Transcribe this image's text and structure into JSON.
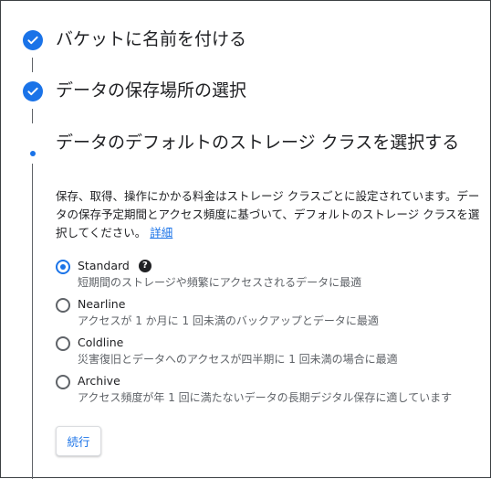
{
  "steps": [
    {
      "title": "バケットに名前を付ける",
      "status": "completed"
    },
    {
      "title": "データの保存場所の選択",
      "status": "completed"
    },
    {
      "title": "データのデフォルトのストレージ クラスを選択する",
      "status": "current"
    }
  ],
  "current_step": {
    "description": "保存、取得、操作にかかる料金はストレージ クラスごとに設定されています。データの保存予定期間とアクセス頻度に基づいて、デフォルトのストレージ クラスを選択してください。",
    "learn_more": "詳細",
    "options": [
      {
        "label": "Standard",
        "description": "短期間のストレージや頻繁にアクセスされるデータに最適",
        "selected": true,
        "has_help": true
      },
      {
        "label": "Nearline",
        "description": "アクセスが 1 か月に 1 回未満のバックアップとデータに最適",
        "selected": false
      },
      {
        "label": "Coldline",
        "description": "災害復旧とデータへのアクセスが四半期に 1 回未満の場合に最適",
        "selected": false
      },
      {
        "label": "Archive",
        "description": "アクセス頻度が年 1 回に満たないデータの長期デジタル保存に適しています",
        "selected": false
      }
    ],
    "help_icon_glyph": "?",
    "continue_label": "続行"
  },
  "colors": {
    "accent": "#1a73e8",
    "text": "#202124",
    "secondary_text": "#5f6368"
  },
  "icons": {
    "completed_step": "check-circle-icon",
    "current_step": "dot-icon",
    "help": "help-icon"
  }
}
